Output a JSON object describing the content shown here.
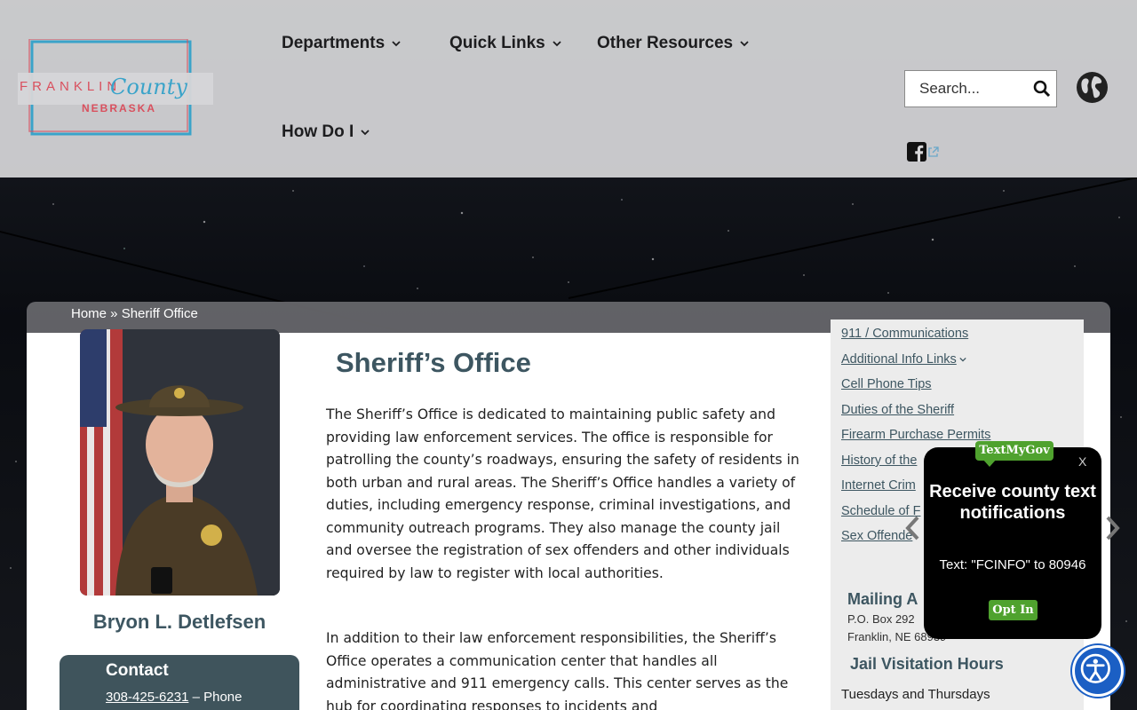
{
  "header": {
    "logo_text": "FRANKLIN County NEBRASKA",
    "nav": [
      {
        "label": "Departments"
      },
      {
        "label": "Quick Links"
      },
      {
        "label": "Other Resources"
      },
      {
        "label": "How Do I"
      }
    ],
    "search_placeholder": "Search..."
  },
  "breadcrumb": {
    "home": "Home",
    "separator": " » ",
    "current": "Sheriff Office"
  },
  "profile": {
    "name": "Bryon L. Detlefsen",
    "contact_title": "Contact",
    "phone": "308-425-6231",
    "phone_suffix": " – Phone"
  },
  "main": {
    "title": "Sheriff’s Office",
    "paragraphs": [
      "The Sheriff’s Office is dedicated to maintaining public safety and providing law enforcement services. The office is responsible for patrolling the county’s roadways, ensuring the safety of residents in both urban and rural areas. The Sheriff’s Office handles a variety of duties, including emergency response, criminal investigations, and community outreach programs. They also manage the county jail and oversee the registration of sex offenders and other individuals required by law to register with local authorities.",
      "In addition to their law enforcement responsibilities, the Sheriff’s Office operates a communication center that handles all administrative and 911 emergency calls. This center serves as the hub for coordinating responses to incidents and"
    ]
  },
  "sidebar": {
    "links": [
      "911 / Communications",
      "Additional Info Links",
      "Cell Phone Tips",
      "Duties of the Sheriff",
      "Firearm Purchase Permits",
      "History of the",
      "Internet Crim",
      "Schedule of F",
      "Sex Offende"
    ],
    "mailing_heading": "Mailing A",
    "mailing_lines": [
      "P.O. Box 292",
      "Franklin, NE 68939"
    ],
    "jail_heading": "Jail Visitation Hours",
    "jail_text": "Tuesdays and Thursdays"
  },
  "popup": {
    "badge": "TextMyGov",
    "close": "X",
    "title": "Receive county text notifications",
    "text": "Text: \"FCINFO\" to 80946",
    "opt_in": "Opt In"
  },
  "colors": {
    "accent": "#3d5661",
    "popup_green": "#4fa22e",
    "accessibility_blue": "#1b5fc4"
  },
  "icons": [
    "chevron-down-icon",
    "search-icon",
    "globe-icon",
    "facebook-icon",
    "external-link-icon",
    "chevron-left-icon",
    "chevron-right-icon",
    "accessibility-icon"
  ]
}
